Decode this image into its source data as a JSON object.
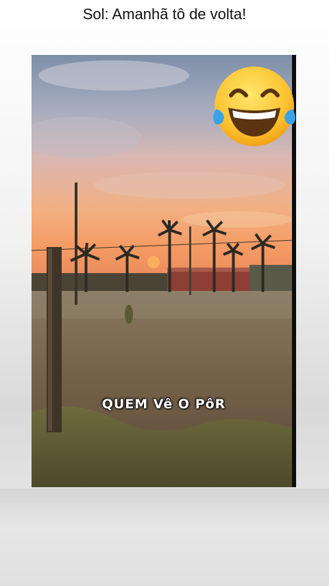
{
  "caption": "Sol: Amanhã tô de volta!",
  "video": {
    "subtitle": "QUEM Vê O PôR"
  },
  "emoji": "laughing-tears-icon"
}
